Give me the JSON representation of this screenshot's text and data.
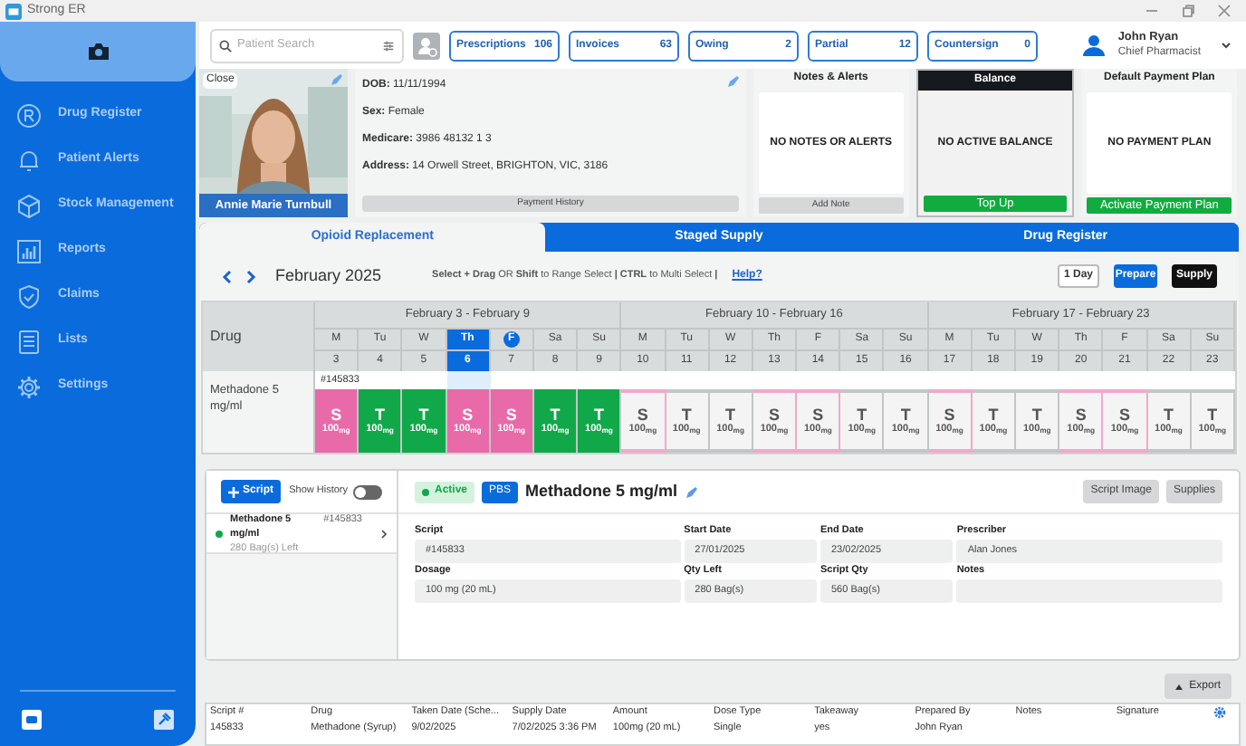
{
  "app": {
    "title": "Strong ER"
  },
  "sidebar": {
    "items": [
      {
        "label": "Drug Register"
      },
      {
        "label": "Patient Alerts"
      },
      {
        "label": "Stock Management"
      },
      {
        "label": "Reports"
      },
      {
        "label": "Claims"
      },
      {
        "label": "Lists"
      },
      {
        "label": "Settings"
      }
    ]
  },
  "search": {
    "placeholder": "Patient Search"
  },
  "counters": [
    {
      "label": "Prescriptions",
      "count": "106"
    },
    {
      "label": "Invoices",
      "count": "63"
    },
    {
      "label": "Owing",
      "count": "2"
    },
    {
      "label": "Partial",
      "count": "12"
    },
    {
      "label": "Countersign",
      "count": "0"
    }
  ],
  "user": {
    "name": "John Ryan",
    "role": "Chief Pharmacist"
  },
  "patient": {
    "name": "Annie Marie Turnbull",
    "close": "Close",
    "fields": [
      {
        "label": "DOB:",
        "value": "11/11/1994"
      },
      {
        "label": "Sex:",
        "value": "Female"
      },
      {
        "label": "Medicare:",
        "value": "3986 48132 1 3"
      },
      {
        "label": "Address:",
        "value": "14 Orwell Street, BRIGHTON, VIC, 3186"
      }
    ],
    "payment_history": "Payment History"
  },
  "panels": [
    {
      "kind": "notes",
      "title": "Notes & Alerts",
      "message": "NO NOTES OR ALERTS",
      "action": "Add Note"
    },
    {
      "kind": "balance",
      "title": "Balance",
      "message": "NO ACTIVE BALANCE",
      "action": "Top Up"
    },
    {
      "kind": "plan",
      "title": "Default Payment Plan",
      "message": "NO PAYMENT PLAN",
      "action": "Activate Payment Plan"
    }
  ],
  "tabs": [
    {
      "label": "Opioid Replacement",
      "selected": true
    },
    {
      "label": "Staged Supply",
      "selected": false
    },
    {
      "label": "Drug Register",
      "selected": false
    }
  ],
  "calendar": {
    "month": "February 2025",
    "hint": "**Select + Drag** OR **Shift** to Range Select **| CTRL** to Multi Select **|**",
    "help": "Help?",
    "buttons": [
      {
        "label": "1 Day",
        "kind": "outline"
      },
      {
        "label": "Prepare",
        "kind": "primary"
      },
      {
        "label": "Supply",
        "kind": "dark"
      }
    ],
    "drug_header": "Drug",
    "weeks": [
      "February 3 - February 9",
      "February 10 - February 16",
      "February 17 - February 23"
    ],
    "days": [
      {
        "label": "M",
        "date": "3",
        "selected": false,
        "today": false
      },
      {
        "label": "Tu",
        "date": "4",
        "selected": false,
        "today": false
      },
      {
        "label": "W",
        "date": "5",
        "selected": false,
        "today": false
      },
      {
        "label": "Th",
        "date": "6",
        "selected": true,
        "today": false
      },
      {
        "label": "F",
        "date": "7",
        "selected": false,
        "today": true
      },
      {
        "label": "Sa",
        "date": "8",
        "selected": false,
        "today": false
      },
      {
        "label": "Su",
        "date": "9",
        "selected": false,
        "today": false
      },
      {
        "label": "M",
        "date": "10",
        "selected": false,
        "today": false
      },
      {
        "label": "Tu",
        "date": "11",
        "selected": false,
        "today": false
      },
      {
        "label": "W",
        "date": "12",
        "selected": false,
        "today": false
      },
      {
        "label": "Th",
        "date": "13",
        "selected": false,
        "today": false
      },
      {
        "label": "F",
        "date": "14",
        "selected": false,
        "today": false
      },
      {
        "label": "Sa",
        "date": "15",
        "selected": false,
        "today": false
      },
      {
        "label": "Su",
        "date": "16",
        "selected": false,
        "today": false
      },
      {
        "label": "M",
        "date": "17",
        "selected": false,
        "today": false
      },
      {
        "label": "Tu",
        "date": "18",
        "selected": false,
        "today": false
      },
      {
        "label": "W",
        "date": "19",
        "selected": false,
        "today": false
      },
      {
        "label": "Th",
        "date": "20",
        "selected": false,
        "today": false
      },
      {
        "label": "F",
        "date": "21",
        "selected": false,
        "today": false
      },
      {
        "label": "Sa",
        "date": "22",
        "selected": false,
        "today": false
      },
      {
        "label": "Su",
        "date": "23",
        "selected": false,
        "today": false
      }
    ],
    "rows": [
      {
        "drug": "Methadone 5 mg/ml",
        "script": "#145833",
        "doses": [
          {
            "letter": "S",
            "amount": "100$_{mg}$",
            "kind": "supervised",
            "supplied": true
          },
          {
            "letter": "T",
            "amount": "100$_{mg}$",
            "kind": "takeaway",
            "supplied": true
          },
          {
            "letter": "T",
            "amount": "100$_{mg}$",
            "kind": "takeaway",
            "supplied": true
          },
          {
            "letter": "S",
            "amount": "100$_{mg}$",
            "kind": "supervised",
            "supplied": true
          },
          {
            "letter": "S",
            "amount": "100$_{mg}$",
            "kind": "supervised",
            "supplied": true
          },
          {
            "letter": "T",
            "amount": "100$_{mg}$",
            "kind": "takeaway",
            "supplied": true
          },
          {
            "letter": "T",
            "amount": "100$_{mg}$",
            "kind": "takeaway",
            "supplied": true
          },
          {
            "letter": "S",
            "amount": "100$_{mg}$",
            "kind": "supervised",
            "supplied": false
          },
          {
            "letter": "T",
            "amount": "100$_{mg}$",
            "kind": "takeaway",
            "supplied": false
          },
          {
            "letter": "T",
            "amount": "100$_{mg}$",
            "kind": "takeaway",
            "supplied": false
          },
          {
            "letter": "S",
            "amount": "100$_{mg}$",
            "kind": "supervised",
            "supplied": false
          },
          {
            "letter": "S",
            "amount": "100$_{mg}$",
            "kind": "supervised",
            "supplied": false
          },
          {
            "letter": "T",
            "amount": "100$_{mg}$",
            "kind": "takeaway",
            "supplied": false
          },
          {
            "letter": "T",
            "amount": "100$_{mg}$",
            "kind": "takeaway",
            "supplied": false
          },
          {
            "letter": "S",
            "amount": "100$_{mg}$",
            "kind": "supervised",
            "supplied": false
          },
          {
            "letter": "T",
            "amount": "100$_{mg}$",
            "kind": "takeaway",
            "supplied": false
          },
          {
            "letter": "T",
            "amount": "100$_{mg}$",
            "kind": "takeaway",
            "supplied": false
          },
          {
            "letter": "S",
            "amount": "100$_{mg}$",
            "kind": "supervised",
            "supplied": false
          },
          {
            "letter": "S",
            "amount": "100$_{mg}$",
            "kind": "supervised",
            "supplied": false
          },
          {
            "letter": "T",
            "amount": "100$_{mg}$",
            "kind": "takeaway",
            "supplied": false
          },
          {
            "letter": "T",
            "amount": "100$_{mg}$",
            "kind": "takeaway",
            "supplied": false
          }
        ]
      }
    ]
  },
  "scripts": {
    "new_button": "Script",
    "history_label": "Show History",
    "history_on": false,
    "items": [
      {
        "name": "Methadone 5 mg/ml",
        "number": "#145833",
        "remaining": "280 Bag(s) Left",
        "active": true,
        "selected": true
      }
    ],
    "detail": {
      "status": "Active",
      "badge": "PBS",
      "title": "Methadone 5 mg/ml",
      "actions": [
        "Script Image",
        "Supplies"
      ],
      "fields": [
        {
          "label": "Script",
          "value": "#145833"
        },
        {
          "label": "Start Date",
          "value": "27/01/2025"
        },
        {
          "label": "End Date",
          "value": "23/02/2025"
        },
        {
          "label": "Prescriber",
          "value": "Alan Jones"
        },
        {
          "label": "Dosage",
          "value": "100 mg (20 mL)"
        },
        {
          "label": "Qty Left",
          "value": "280 Bag(s)"
        },
        {
          "label": "Script Qty",
          "value": "560 Bag(s)"
        },
        {
          "label": "Notes"
        }
      ]
    }
  },
  "export": {
    "label": "Export"
  },
  "table": {
    "columns": [
      "Script #",
      "Drug",
      "Taken Date (Sche...",
      "Supply Date",
      "Amount",
      "Dose Type",
      "Takeaway",
      "Prepared By",
      "Notes",
      "Signature"
    ],
    "rows": [
      [
        "145833",
        "Methadone (Syrup)",
        "9/02/2025",
        "7/02/2025 3:36 PM",
        "100mg (20 mL)",
        "Single",
        "yes",
        "John Ryan",
        "",
        ""
      ]
    ]
  }
}
